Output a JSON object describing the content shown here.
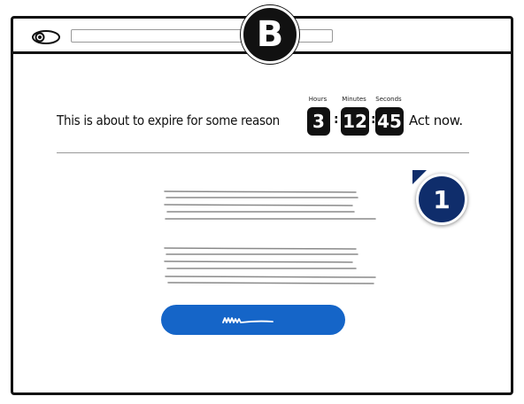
{
  "variant": {
    "label": "B"
  },
  "step": {
    "label": "1"
  },
  "countdown": {
    "message": "This is about to expire for some reason",
    "separator": ":",
    "units": [
      {
        "label": "Hours",
        "value": "3"
      },
      {
        "label": "Minutes",
        "value": "12"
      },
      {
        "label": "Seconds",
        "value": "45"
      }
    ],
    "cta_text": "Act now."
  },
  "colors": {
    "ink": "#111111",
    "step_badge": "#0f2d6b",
    "button": "#1565c8",
    "placeholder_line": "#8a8a8a"
  },
  "icons": {
    "browser_logo": "eye-icon",
    "button_label": "squiggle-icon"
  }
}
